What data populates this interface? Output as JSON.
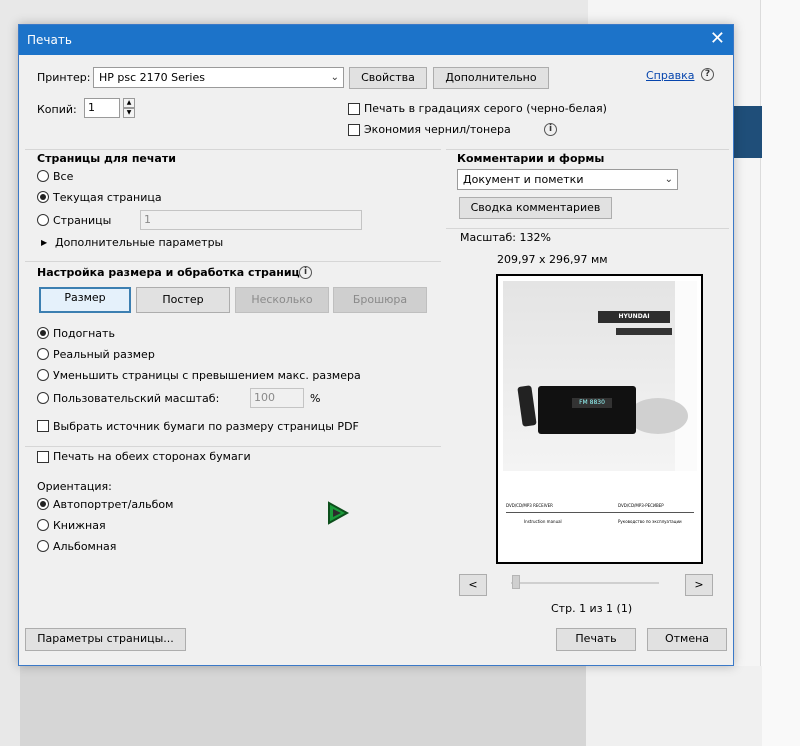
{
  "window": {
    "title": "Печать",
    "close_glyph": "✕"
  },
  "printer": {
    "label": "Принтер:",
    "selected": "HP psc 2170 Series",
    "properties_button": "Свойства",
    "advanced_button": "Дополнительно",
    "help_link": "Справка",
    "copies_label": "Копий:",
    "copies_value": "1",
    "grayscale_label": "Печать в градациях серого (черно-белая)",
    "grayscale_checked": false,
    "save_ink_label": "Экономия чернил/тонера",
    "save_ink_checked": false
  },
  "pages": {
    "heading": "Страницы для печати",
    "all_label": "Все",
    "current_label": "Текущая страница",
    "pages_label": "Страницы",
    "pages_value": "1",
    "more_options_label": "Дополнительные параметры",
    "selected": "current"
  },
  "sizing": {
    "heading": "Настройка размера и обработка страниц",
    "tabs": [
      {
        "label": "Размер",
        "state": "selected"
      },
      {
        "label": "Постер",
        "state": "normal"
      },
      {
        "label": "Несколько",
        "state": "disabled"
      },
      {
        "label": "Брошюра",
        "state": "disabled"
      }
    ],
    "fit_label": "Подогнать",
    "actual_label": "Реальный размер",
    "shrink_label": "Уменьшить страницы с превышением макс. размера",
    "custom_label": "Пользовательский масштаб:",
    "custom_value": "100",
    "custom_unit": "%",
    "paper_source_label": "Выбрать источник бумаги по размеру страницы PDF",
    "selected": "fit"
  },
  "duplex": {
    "label": "Печать на обеих сторонах бумаги",
    "checked": false
  },
  "orientation": {
    "heading": "Ориентация:",
    "auto_label": "Автопортрет/альбом",
    "portrait_label": "Книжная",
    "landscape_label": "Альбомная",
    "selected": "auto"
  },
  "comments": {
    "heading": "Комментарии и формы",
    "selected": "Документ и пометки",
    "summary_button": "Сводка комментариев"
  },
  "preview": {
    "scale_label": "Масштаб: 132%",
    "size_label": "209,97 x 296,97 мм",
    "prev_glyph": "<",
    "next_glyph": ">",
    "page_info": "Стр. 1 из 1 (1)",
    "page_logo_text": "HYUNDAI",
    "page_screen_text": "FM 8830",
    "page_text_left": "DVD/CD/MP3 RECEIVER",
    "page_text_right": "DVD/CD/MP3-РЕСИВЕР",
    "page_text_left2": "Instruction manual",
    "page_text_right2": "Руководство по эксплуатации"
  },
  "footer": {
    "page_setup_button": "Параметры страницы...",
    "print_button": "Печать",
    "cancel_button": "Отмена"
  },
  "colors": {
    "titlebar": "#1c73c9",
    "accent_border": "#3c7fb1",
    "cursor": "#1a9c3a"
  }
}
